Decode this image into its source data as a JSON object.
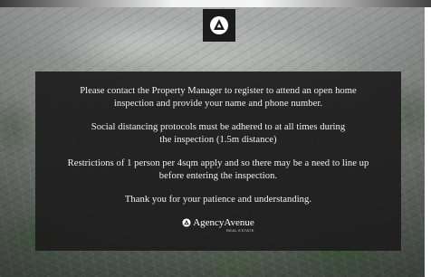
{
  "logo": {
    "icon": "agency-avenue-emblem-icon"
  },
  "notice": {
    "paragraphs": [
      {
        "lines": [
          "Please contact the Property Manager to register to attend an open home",
          "inspection and provide your name and phone number."
        ]
      },
      {
        "lines": [
          "Social distancing protocols must be adhered to at all times during",
          "the inspection (1.5m distance)"
        ]
      },
      {
        "lines": [
          "Restrictions of 1 person per 4sqm apply and so there may be a need to line up",
          "before entering the inspection."
        ]
      },
      {
        "lines": [
          "Thank you for your patience and understanding."
        ]
      }
    ]
  },
  "brand": {
    "name": "AgencyAvenue",
    "subtitle": "REAL ESTATE",
    "icon": "agency-avenue-emblem-icon"
  },
  "colors": {
    "panel_background": "#1c1c1c",
    "text": "#f2f2f2",
    "logo_box": "#1b1b1b"
  }
}
